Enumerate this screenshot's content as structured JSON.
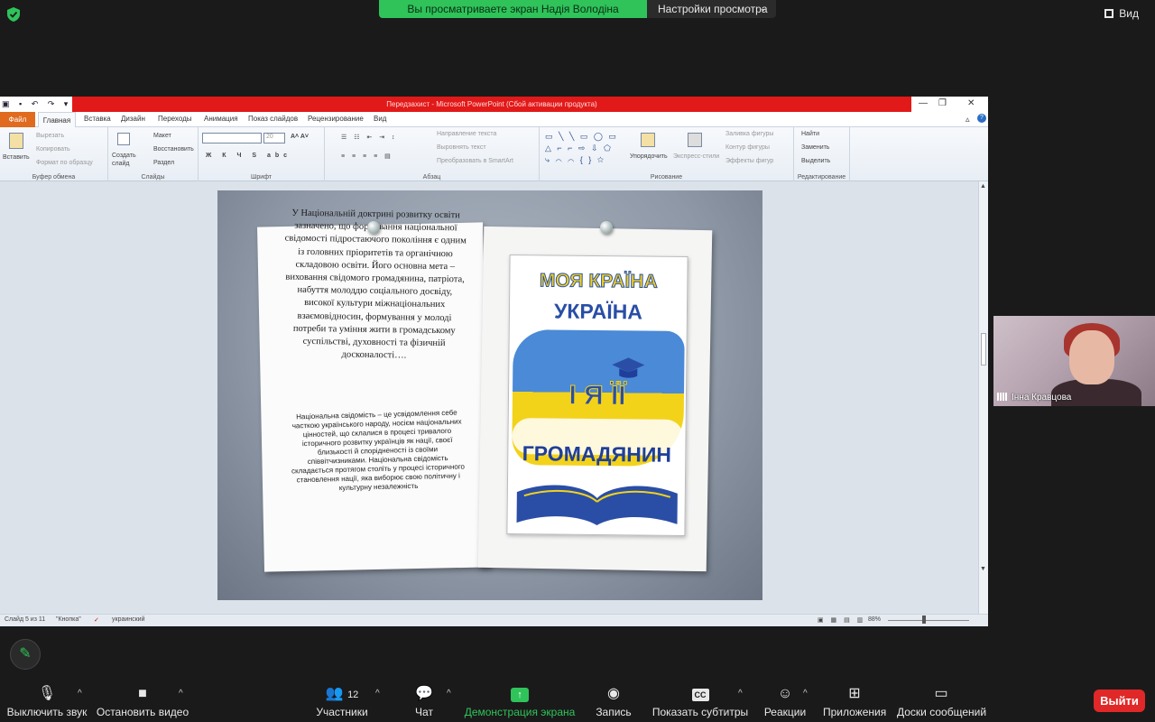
{
  "zoom": {
    "banner_text": "Вы просматриваете экран Надія Володіна",
    "view_options_label": "Настройки просмотра",
    "view_label": "Вид",
    "participant_name": "Інна Кравцова",
    "toolbar": {
      "mute": "Выключить звук",
      "video": "Остановить видео",
      "participants": "Участники",
      "participants_count": "12",
      "chat": "Чат",
      "share": "Демонстрация экрана",
      "record": "Запись",
      "captions": "Показать субтитры",
      "captions_icon": "CC",
      "reactions": "Реакции",
      "apps": "Приложения",
      "whiteboard": "Доски сообщений",
      "leave": "Выйти"
    },
    "accent_green": "#2fc35a",
    "leave_red": "#e02828"
  },
  "ppt": {
    "window_title": "Передзахист - Microsoft PowerPoint (Сбой активации продукта)",
    "tabs": [
      "Файл",
      "Главная",
      "Вставка",
      "Дизайн",
      "Переходы",
      "Анимация",
      "Показ слайдов",
      "Рецензирование",
      "Вид"
    ],
    "ribbon": {
      "clipboard": {
        "paste": "Вставить",
        "cut": "Вырезать",
        "copy": "Копировать",
        "format_painter": "Формат по образцу",
        "label": "Буфер обмена"
      },
      "slides": {
        "new_slide": "Создать слайд",
        "layout": "Макет",
        "reset": "Восстановить",
        "section": "Раздел",
        "label": "Слайды"
      },
      "font": {
        "size": "20",
        "label": "Шрифт"
      },
      "paragraph": {
        "text_direction": "Направление текста",
        "align_text": "Выровнять текст",
        "smartart": "Преобразовать в SmartArt",
        "label": "Абзац"
      },
      "drawing": {
        "arrange": "Упорядочить",
        "quick_styles": "Экспресс-стили",
        "shape_fill": "Заливка фигуры",
        "shape_outline": "Контур фигуры",
        "shape_effects": "Эффекты фигур",
        "label": "Рисование"
      },
      "editing": {
        "find": "Найти",
        "replace": "Заменить",
        "select": "Выделить",
        "label": "Редактирование"
      }
    },
    "status": {
      "slide": "Слайд 5 из 11",
      "theme": "\"Кнопка\"",
      "language": "украинский",
      "zoom": "88%"
    },
    "slide": {
      "paragraph1": "У Національній доктрині розвитку освіти зазначено, що формування національної свідомості підростаючого покоління є одним із головних пріоритетів та органічною складовою освіти. Його основна мета – виховання свідомого громадянина, патріота, набуття молоддю соціального досвіду, високої культури міжнаціональних взаємовідносин, формування у молоді потреби та уміння жити в громадському суспільстві, духовності та фізичній досконалості….",
      "paragraph2": "Національна свідомість – це усвідомлення себе часткою українського народу, носієм національних цінностей, що склалися в процесі тривалого історичного розвитку українців як нації, своєї близькості й спорідненості із своїми співвітчизниками. Національна свідомість складається протягом століть у процесі історичного становлення нації, яка виборює свою політичну і культурну незалежність",
      "poster_line1": "МОЯ КРАЇНА",
      "poster_line2": "УКРАЇНА",
      "poster_line3": "І Я ЇЇ",
      "poster_line4": "ГРОМАДЯНИН"
    }
  }
}
